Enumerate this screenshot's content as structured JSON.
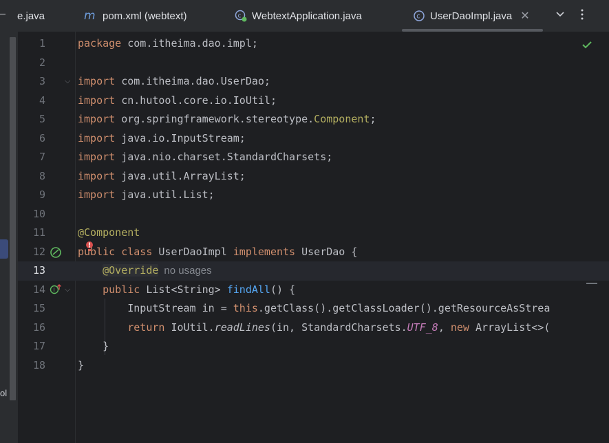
{
  "tabs": [
    {
      "label": "e.java"
    },
    {
      "label": "pom.xml (webtext)",
      "icon": "maven-icon"
    },
    {
      "label": "WebtextApplication.java",
      "icon": "spring-boot-class-icon"
    },
    {
      "label": "UserDaoImpl.java",
      "icon": "class-icon",
      "active": true
    }
  ],
  "sidebar": {
    "fragment": "ol"
  },
  "lines": [
    {
      "n": "1"
    },
    {
      "n": "2"
    },
    {
      "n": "3"
    },
    {
      "n": "4"
    },
    {
      "n": "5"
    },
    {
      "n": "6"
    },
    {
      "n": "7"
    },
    {
      "n": "8"
    },
    {
      "n": "9"
    },
    {
      "n": "10"
    },
    {
      "n": "11"
    },
    {
      "n": "12"
    },
    {
      "n": "13"
    },
    {
      "n": "14"
    },
    {
      "n": "15"
    },
    {
      "n": "16"
    },
    {
      "n": "17"
    },
    {
      "n": "18"
    }
  ],
  "code": {
    "l1": {
      "kw": "package",
      "rest": " com.itheima.dao.impl;"
    },
    "l3": {
      "kw": "import",
      "rest": " com.itheima.dao.UserDao;"
    },
    "l4": {
      "kw": "import",
      "rest": " cn.hutool.core.io.IoUtil;"
    },
    "l5": {
      "kw": "import",
      "rest": " org.springframework.stereotype.",
      "ann": "Component",
      "end": ";"
    },
    "l6": {
      "kw": "import",
      "rest": " java.io.InputStream;"
    },
    "l7": {
      "kw": "import",
      "rest": " java.nio.charset.StandardCharsets;"
    },
    "l8": {
      "kw": "import",
      "rest": " java.util.ArrayList;"
    },
    "l9": {
      "kw": "import",
      "rest": " java.util.List;"
    },
    "l11": {
      "ann": "@Component"
    },
    "l12": {
      "kw1": "public class",
      "name": " UserDaoImpl ",
      "kw2": "implements",
      "rest": " UserDao {"
    },
    "l13": {
      "ann": "@Override",
      "hint": "no usages"
    },
    "l14": {
      "kw": "public",
      "t": " List<String> ",
      "fn": "findAll",
      "rest": "() {"
    },
    "l15": {
      "a": "InputStream in = ",
      "kw": "this",
      "b": ".getClass().getClassLoader().getResourceAsStrea"
    },
    "l16": {
      "kw": "return",
      "a": " IoUtil.",
      "it": "readLines",
      "b": "(in, StandardCharsets.",
      "st": "UTF_8",
      "c": ", ",
      "kw2": "new",
      "d": " ArrayList<>("
    },
    "l17": {
      "rest": "}"
    },
    "l18": {
      "rest": "}"
    }
  },
  "colors": {
    "keyword": "#cf8e6d",
    "annotation": "#b3ae60",
    "function": "#56a8f5",
    "static_field": "#c77dbb",
    "text": "#bcbec4",
    "background": "#1e1f22"
  }
}
